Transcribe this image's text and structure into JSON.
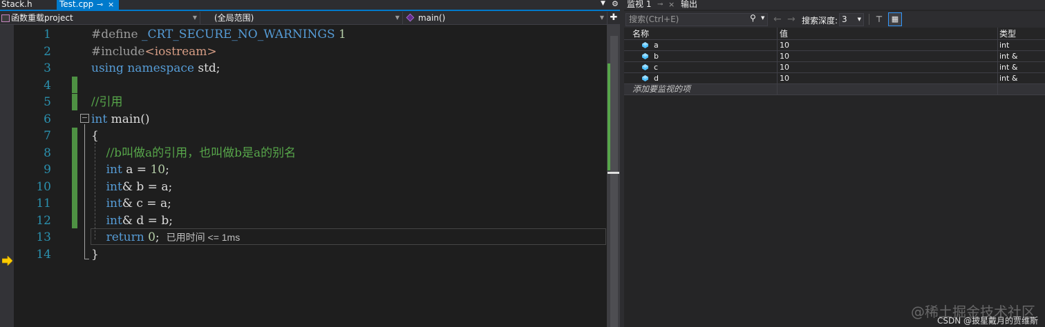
{
  "editor": {
    "tabs": {
      "inactive": "Stack.h",
      "active": "Test.cpp",
      "pin_glyph": "⊸",
      "close_glyph": "×"
    },
    "navbar": {
      "project": "函数重载project",
      "scope": "(全局范围)",
      "function": "main()"
    },
    "line_numbers": [
      "1",
      "2",
      "3",
      "4",
      "5",
      "6",
      "7",
      "8",
      "9",
      "10",
      "11",
      "12",
      "13",
      "14"
    ],
    "code": {
      "l1_directive": "#define",
      "l1_macro": "_CRT_SECURE_NO_WARNINGS",
      "l1_value": "1",
      "l2_directive": "#include",
      "l2_header": "<iostream>",
      "l3_using": "using",
      "l3_namespace": "namespace",
      "l3_rest": "std;",
      "l5_comment": "//引用",
      "l6_type": "int",
      "l6_rest": "main()",
      "l7_brace": "{",
      "l8_comment": "//b叫做a的引用，也叫做b是a的别名",
      "l9_type": "int",
      "l9_mid": "a = ",
      "l9_num": "10",
      "l9_end": ";",
      "l10_type": "int",
      "l10_rest": "& b = a;",
      "l11_type": "int",
      "l11_rest": "& c = a;",
      "l12_type": "int",
      "l12_rest": "& d = b;",
      "l13_kw": "return",
      "l13_num": "0",
      "l13_end": ";",
      "l13_perf": "已用时间 <= 1ms",
      "l14_brace": "}"
    }
  },
  "watch": {
    "tab_title": "监视 1",
    "tab_pin": "⊸",
    "tab_close": "×",
    "output_tab": "输出",
    "search_placeholder": "搜索(Ctrl+E)",
    "depth_label": "搜索深度:",
    "depth_value": "3",
    "columns": {
      "name": "名称",
      "value": "值",
      "type": "类型"
    },
    "rows": [
      {
        "name": "a",
        "value": "10",
        "type": "int"
      },
      {
        "name": "b",
        "value": "10",
        "type": "int &"
      },
      {
        "name": "c",
        "value": "10",
        "type": "int &"
      },
      {
        "name": "d",
        "value": "10",
        "type": "int &"
      }
    ],
    "add_item": "添加要监视的项"
  },
  "footer": {
    "watermark": "@稀土掘金技术社区",
    "credit": "CSDN @披星戴月的贾维斯"
  },
  "icons": {
    "debug_arrow": "current-statement-arrow-icon",
    "var": "watch-variable-icon",
    "search": "search-icon"
  },
  "colors": {
    "accent": "#007acc",
    "keyword": "#569cd6",
    "comment": "#57a64a",
    "string": "#d69d85",
    "line_number": "#2b91af",
    "debug_arrow": "#ffcc00"
  }
}
